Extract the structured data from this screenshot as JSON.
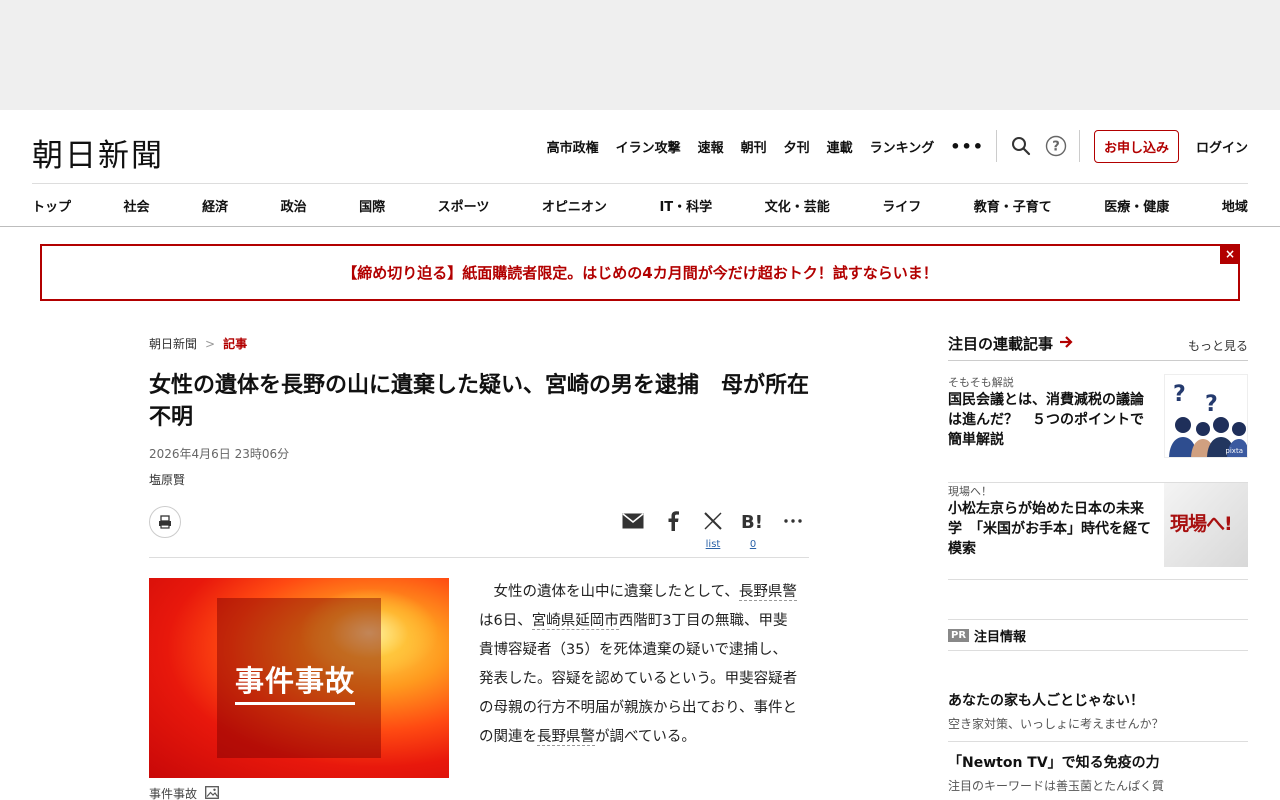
{
  "site": {
    "logo": "朝日新聞"
  },
  "topnav": {
    "links": [
      "高市政権",
      "イラン攻撃",
      "速報",
      "朝刊",
      "夕刊",
      "連載",
      "ランキング"
    ],
    "more": "•••",
    "search_icon": "search-icon",
    "help_icon": "help-icon",
    "subscribe": "お申し込み",
    "login": "ログイン"
  },
  "catnav": [
    "トップ",
    "社会",
    "経済",
    "政治",
    "国際",
    "スポーツ",
    "オピニオン",
    "IT・科学",
    "文化・芸能",
    "ライフ",
    "教育・子育て",
    "医療・健康",
    "地域"
  ],
  "promo": {
    "text": "【締め切り迫る】紙面購読者限定。はじめの4カ月間が今だけ超おトク！試すならいま！",
    "close": "×",
    "color": "#b20000"
  },
  "breadcrumb": {
    "home": "朝日新聞",
    "sep": ">",
    "current": "記事"
  },
  "article": {
    "headline": "女性の遺体を長野の山に遺棄した疑い、宮崎の男を逮捕　母が所在不明",
    "date": "2026年4月6日 23時06分",
    "author": "塩原賢",
    "share": {
      "x_count": "list",
      "hatena_count": "0"
    },
    "photo": {
      "title": "事件事故",
      "caption": "事件事故"
    },
    "body": {
      "p1": "女性の遺体を山中に遺棄したとして、",
      "l1": "長野県警",
      "p2": "は6日、",
      "l2": "宮崎県延岡市",
      "p3": "西階町3丁目の無職、甲斐貴博容疑者（35）を死体遺棄の疑いで逮捕し、発表した。容疑を認めているという。甲斐容疑者の母親の行方不明届が親族から出ており、事件との関連を",
      "l3": "長野県警",
      "p4": "が調べている。"
    }
  },
  "sidebar": {
    "title": "注目の連載記事",
    "more": "もっと見る",
    "items": [
      {
        "kicker": "そもそも解説",
        "title": "国民会議とは、消費減税の議論は進んだ？　５つのポイントで簡単解説",
        "thumb_credit": "pixta"
      },
      {
        "kicker": "現場へ！",
        "title": "小松左京らが始めた日本の未来学　「米国がお手本」時代を経て模索",
        "thumb_text": "現場へ!"
      }
    ]
  },
  "pr": {
    "badge": "PR",
    "title": "注目情報",
    "items": [
      {
        "title": "あなたの家も人ごとじゃない！",
        "desc": "空き家対策、いっしょに考えませんか？"
      },
      {
        "title": "「Newton TV」で知る免疫の力",
        "desc": "注目のキーワードは善玉菌とたんぱく質"
      }
    ]
  }
}
